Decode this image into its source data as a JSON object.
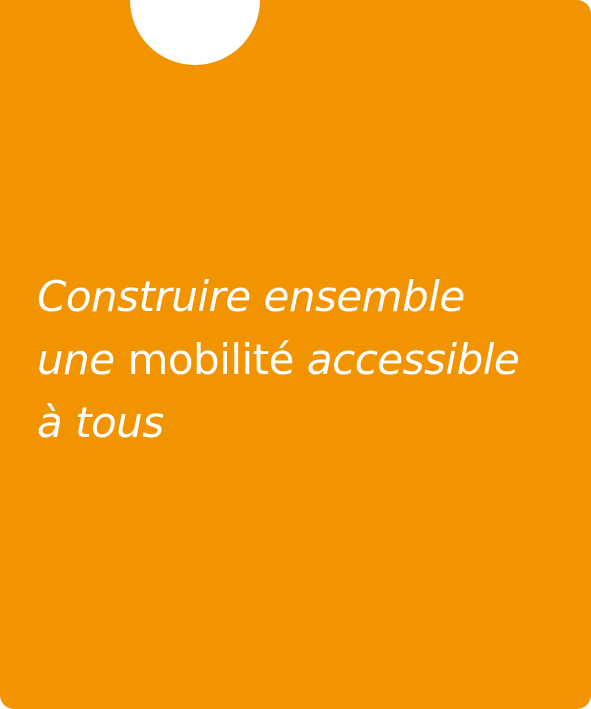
{
  "colors": {
    "card_background": "#F29400",
    "notch": "#FFFFFF",
    "text": "#FFFFFF"
  },
  "headline": {
    "line1": "Construire ensemble",
    "line2_part1": "une",
    "line2_part2": "mobilité",
    "line2_part3": "accessible",
    "line3": "à tous"
  }
}
